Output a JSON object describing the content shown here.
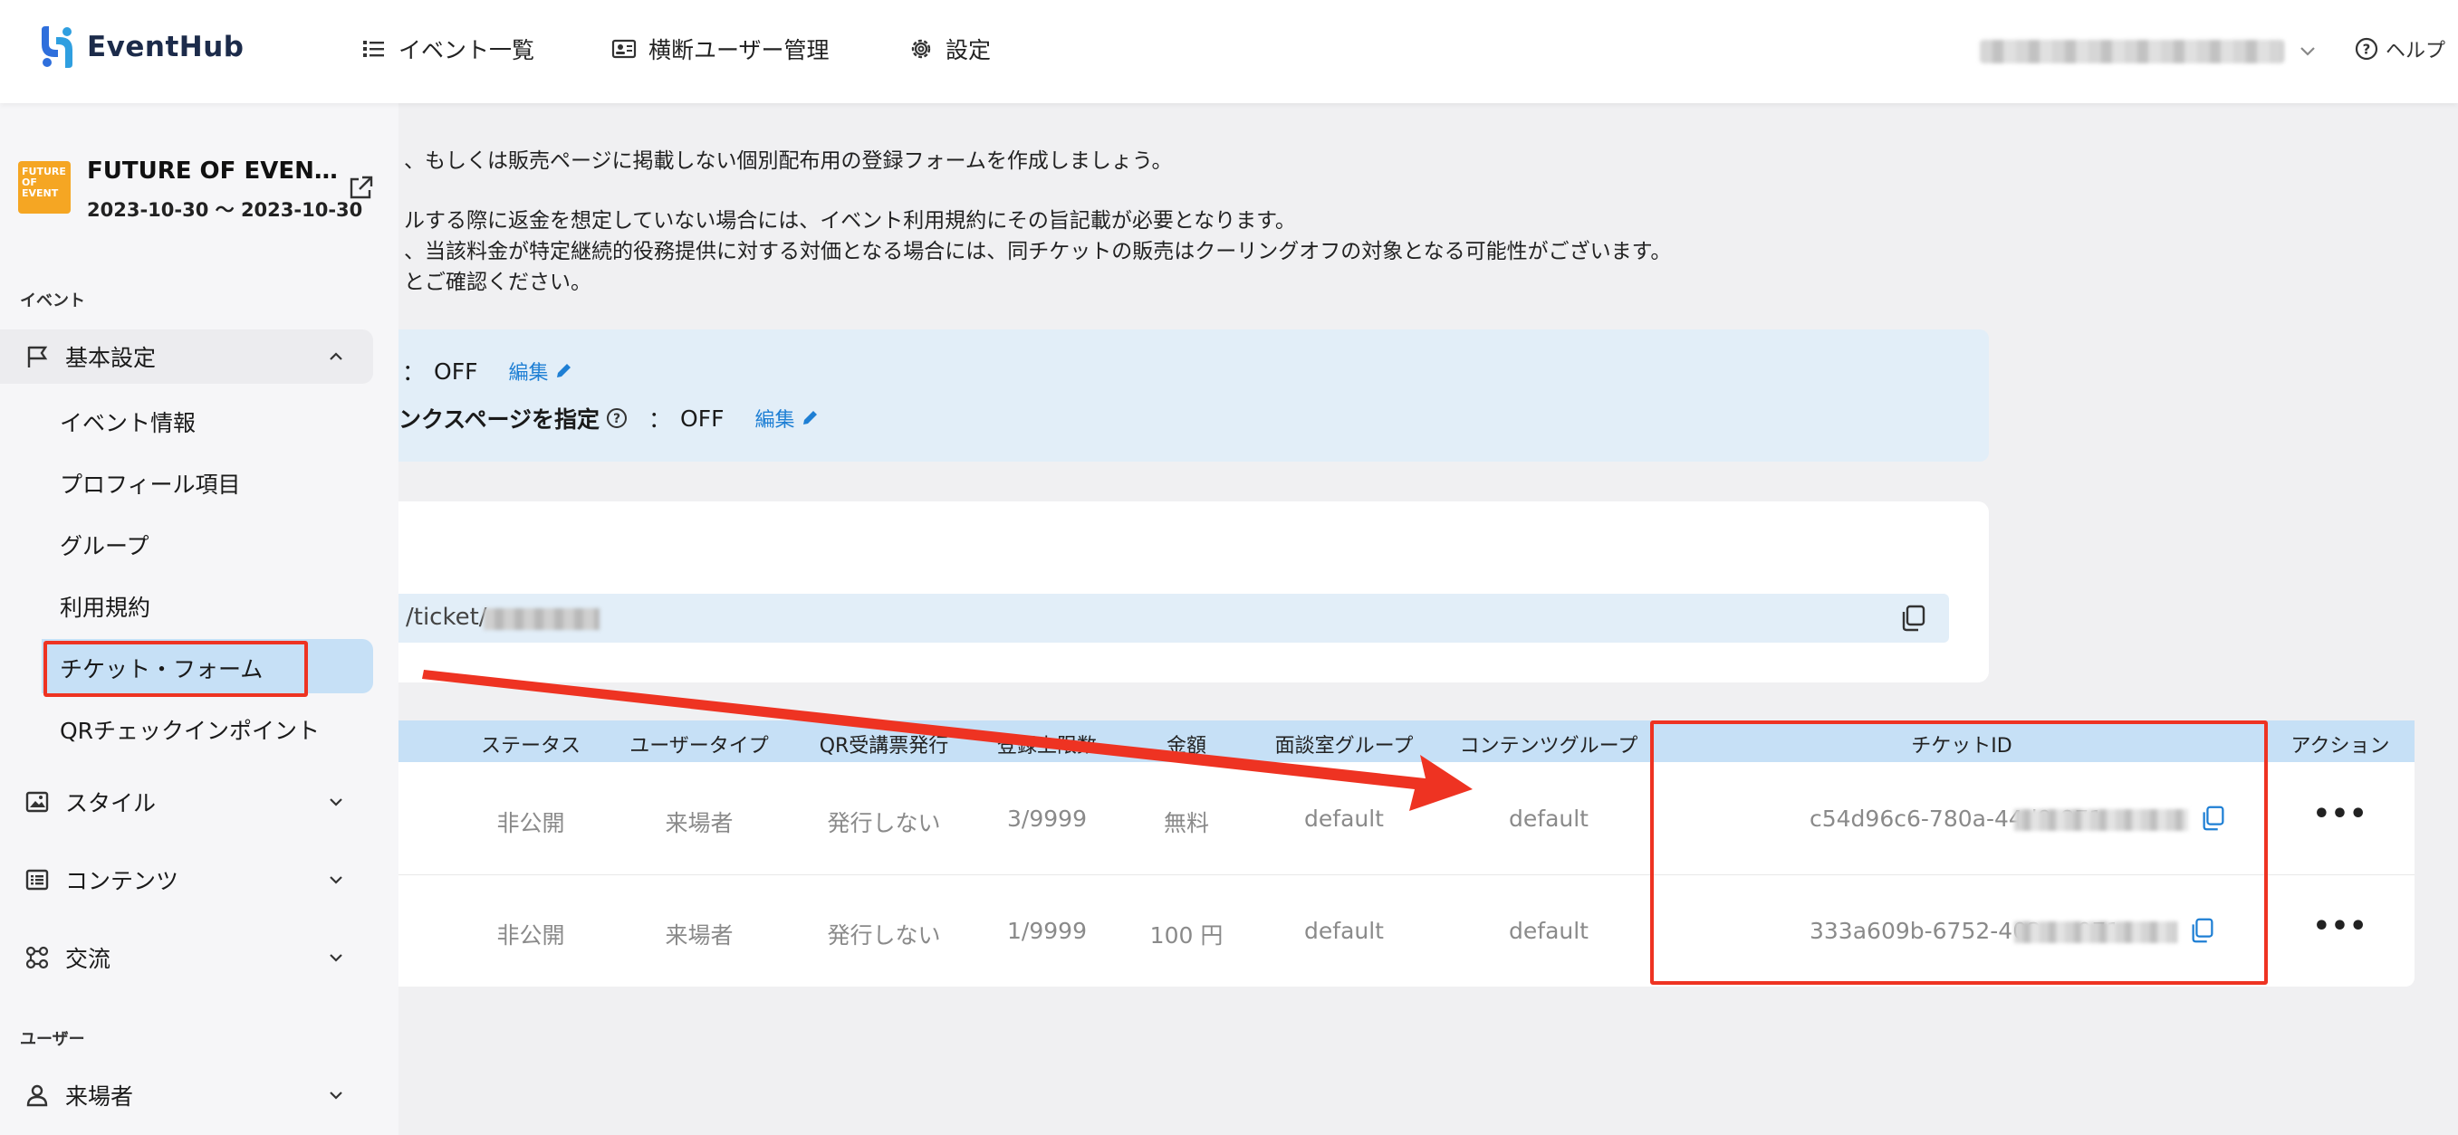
{
  "header": {
    "logo_text": "EventHub",
    "nav": [
      {
        "label": "イベント一覧",
        "icon": "list-icon"
      },
      {
        "label": "横断ユーザー管理",
        "icon": "id-card-icon"
      },
      {
        "label": "設定",
        "icon": "gear-icon"
      }
    ],
    "help_label": "ヘルプ"
  },
  "sidebar": {
    "event": {
      "title": "FUTURE OF EVEN…",
      "dates": "2023-10-30 〜 2023-10-30",
      "thumb_text": "FUTURE OF EVENT"
    },
    "section_event": "イベント",
    "basic_settings": "基本設定",
    "children": [
      "イベント情報",
      "プロフィール項目",
      "グループ",
      "利用規約",
      "チケット・フォーム",
      "QRチェックインポイント"
    ],
    "style": "スタイル",
    "contents": "コンテンツ",
    "exchange": "交流",
    "section_user": "ユーザー",
    "visitors": "来場者"
  },
  "main": {
    "desc_lines": [
      "、もしくは販売ページに掲載しない個別配布用の登録フォームを作成しましょう。",
      "ルする際に返金を想定していない場合には、イベント利用規約にその旨記載が必要となります。",
      "、当該料金が特定継続的役務提供に対する対価となる場合には、同チケットの販売はクーリングオフの対象となる可能性がございます。",
      "とご確認ください。"
    ],
    "info": {
      "row1_value": "OFF",
      "row2_label": "ンクスページを指定",
      "row2_value": "OFF",
      "colon": "：",
      "edit_label": "編集"
    },
    "url_text": "/ticket/",
    "table": {
      "headers": [
        "ステータス",
        "ユーザータイプ",
        "QR受講票発行",
        "登録上限数",
        "金額",
        "面談室グループ",
        "コンテンツグループ",
        "チケットID",
        "アクション"
      ],
      "rows": [
        {
          "status": "非公開",
          "user_type": "来場者",
          "qr": "発行しない",
          "limit": "3/9999",
          "price": "無料",
          "room_group": "default",
          "content_group": "default",
          "ticket_id": "c54d96c6-780a-44d9-871e-"
        },
        {
          "status": "非公開",
          "user_type": "来場者",
          "qr": "発行しない",
          "limit": "1/9999",
          "price": "100 円",
          "room_group": "default",
          "content_group": "default",
          "ticket_id": "333a609b-6752-402a-a071-"
        }
      ],
      "actions_label": "•••"
    }
  },
  "colors": {
    "accent": "#1e7fd4",
    "highlight": "#ee3322",
    "active_bg": "#c6e0f6",
    "info_bg": "#e2eef8"
  }
}
